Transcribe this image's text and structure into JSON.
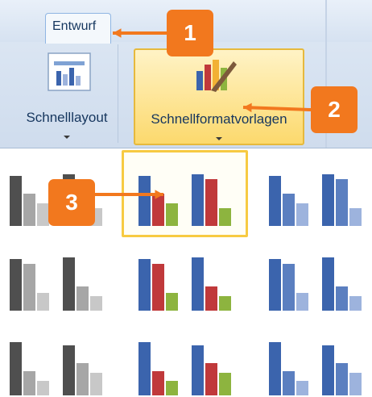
{
  "ribbon": {
    "active_tab": "Entwurf",
    "buttons": [
      {
        "label": "Schnelllayout"
      },
      {
        "label": "Schnellformatvorlagen"
      }
    ]
  },
  "callouts": [
    "1",
    "2",
    "3"
  ],
  "colors": {
    "callout": "#f2781e",
    "selection_border": "#f7ca42",
    "bar_blue": "#3b64ad",
    "bar_red": "#c0393b",
    "bar_green": "#8db43f",
    "bar_dark": "#4f4f4f",
    "bar_gray": "#a6a6a6",
    "bar_lightblue": "#9db3dd"
  },
  "gallery": {
    "style_groups": [
      {
        "name": "gray",
        "rows": 3
      },
      {
        "name": "colorful",
        "rows": 3,
        "selected_row": 1
      },
      {
        "name": "blue",
        "rows": 3
      }
    ]
  }
}
